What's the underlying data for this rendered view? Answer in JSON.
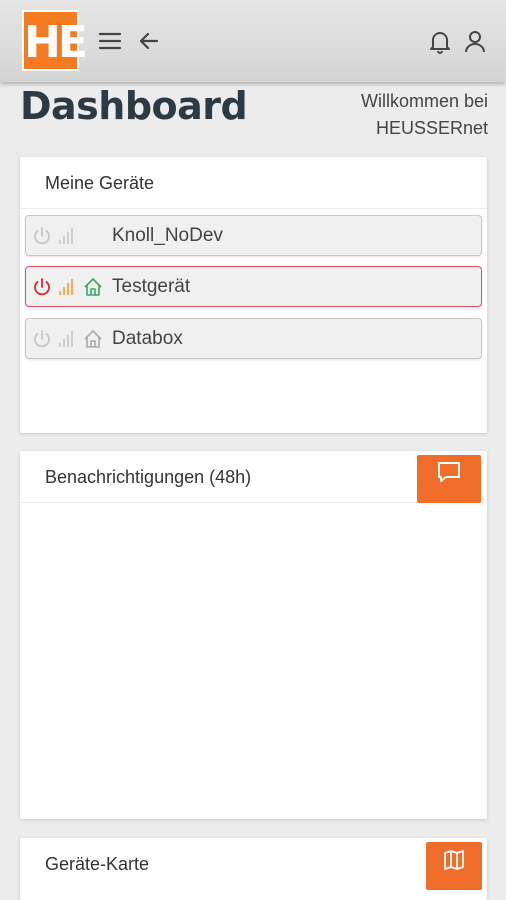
{
  "header": {
    "logo_text": "HE",
    "menu_icon": "hamburger-icon",
    "back_icon": "arrow-left-icon",
    "bell_icon": "bell-icon",
    "user_icon": "user-icon",
    "logo_color": "#f47b20"
  },
  "page": {
    "title": "Dashboard",
    "welcome_line1": "Willkommen bei",
    "welcome_line2": "HEUSSERnet"
  },
  "devices_card": {
    "title": "Meine Geräte",
    "devices": [
      {
        "name": "Knoll_NoDev",
        "status": "inactive"
      },
      {
        "name": "Testgerät",
        "status": "alert"
      },
      {
        "name": "Databox",
        "status": "inactive"
      }
    ]
  },
  "notifications_card": {
    "title": "Benachrichtigungen (48h)",
    "button_icon": "chat-icon"
  },
  "map_card": {
    "title": "Geräte-Karte",
    "button_icon": "map-icon"
  },
  "colors": {
    "accent": "#ef6d29",
    "alert_red": "#d9283a",
    "signal_orange": "#f0a030",
    "home_green": "#3aa86a",
    "inactive_gray": "#c6c6c6"
  }
}
